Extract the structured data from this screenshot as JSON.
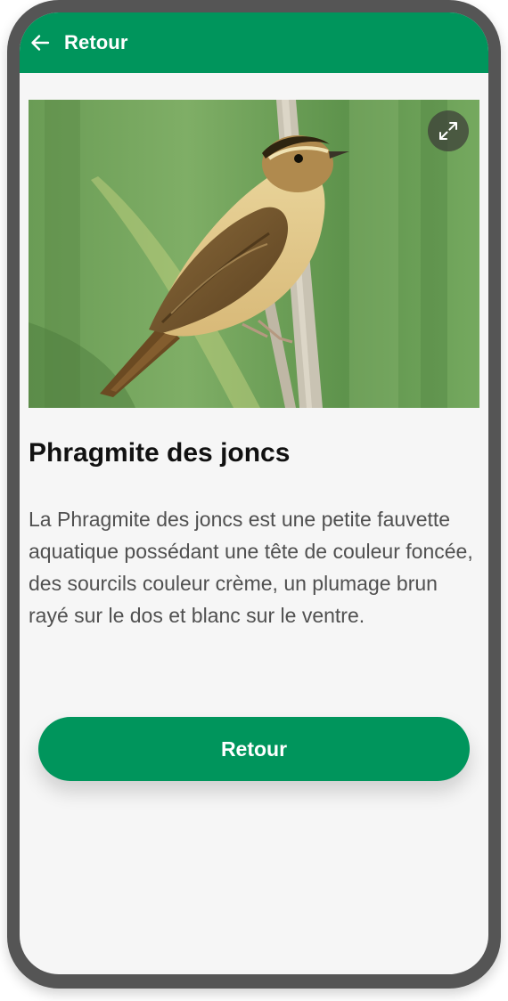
{
  "header": {
    "back_icon": "arrow-left-icon",
    "title": "Retour"
  },
  "image": {
    "alt": "Phragmite des joncs",
    "expand_icon": "expand-icon"
  },
  "content": {
    "title": "Phragmite des joncs",
    "description": "La Phragmite des joncs est une petite fauvette aquatique possédant une tête de couleur foncée, des sourcils couleur crème, un plumage brun rayé sur le dos et blanc sur le ventre."
  },
  "footer": {
    "button_label": "Retour"
  },
  "colors": {
    "primary": "#00955c",
    "background": "#f6f6f6",
    "device_frame": "#555555"
  }
}
